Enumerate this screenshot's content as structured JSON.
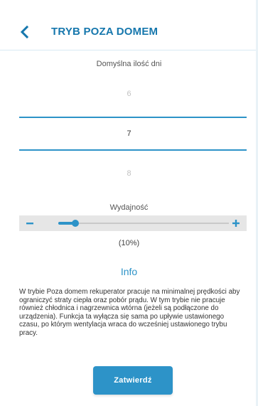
{
  "header": {
    "title": "TRYB POZA DOMEM"
  },
  "days_picker": {
    "label": "Domyślna ilość dni",
    "prev_value": "6",
    "selected_value": "7",
    "next_value": "8"
  },
  "efficiency": {
    "label": "Wydajność",
    "value_fraction": 0.1,
    "value_text": "(10%)"
  },
  "info": {
    "title": "Info",
    "text": "W trybie Poza domem rekuperator pracuje na minimalnej prędkości aby ograniczyć straty ciepła oraz pobór prądu. W tym trybie nie pracuje również chłodnica i nagrzewnica wtórna (jeżeli są podłączone do urządzenia). Funkcja ta wyłącza się sama po upływie ustawionego czasu, po którym wentylacja wraca do wcześniej ustawionego trybu pracy."
  },
  "confirm_button": {
    "label": "Zatwierdź"
  },
  "colors": {
    "accent": "#2d93c8",
    "title": "#1677ad"
  }
}
